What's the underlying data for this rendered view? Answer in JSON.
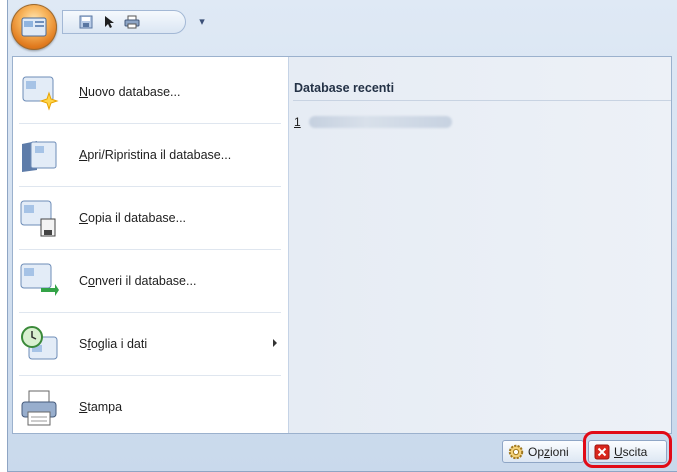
{
  "quick_access": {
    "buttons": [
      "save-icon",
      "pointer-icon",
      "print-icon"
    ],
    "dropdown_icon": "chevron-down-icon"
  },
  "menu": {
    "items": [
      {
        "label_pre": "",
        "label_u": "N",
        "label_post": "uovo database...",
        "icon": "new-database-icon",
        "has_submenu": false
      },
      {
        "label_pre": "",
        "label_u": "A",
        "label_post": "pri/Ripristina il database...",
        "icon": "open-database-icon",
        "has_submenu": false
      },
      {
        "label_pre": "",
        "label_u": "C",
        "label_post": "opia il database...",
        "icon": "copy-database-icon",
        "has_submenu": false
      },
      {
        "label_pre": "C",
        "label_u": "o",
        "label_post": "nveri il database...",
        "icon": "convert-database-icon",
        "has_submenu": false
      },
      {
        "label_pre": "S",
        "label_u": "f",
        "label_post": "oglia i dati",
        "icon": "browse-data-icon",
        "has_submenu": true
      },
      {
        "label_pre": "",
        "label_u": "S",
        "label_post": "tampa",
        "icon": "printer-icon",
        "has_submenu": false
      }
    ]
  },
  "recent": {
    "title": "Database recenti",
    "items": [
      {
        "number": "1"
      }
    ]
  },
  "footer": {
    "options": {
      "pre": "Op",
      "u": "z",
      "post": "ioni"
    },
    "exit": {
      "pre": "",
      "u": "U",
      "post": "scita"
    }
  },
  "colors": {
    "accent": "#e10b17",
    "panel_border": "#9bb1cd"
  }
}
